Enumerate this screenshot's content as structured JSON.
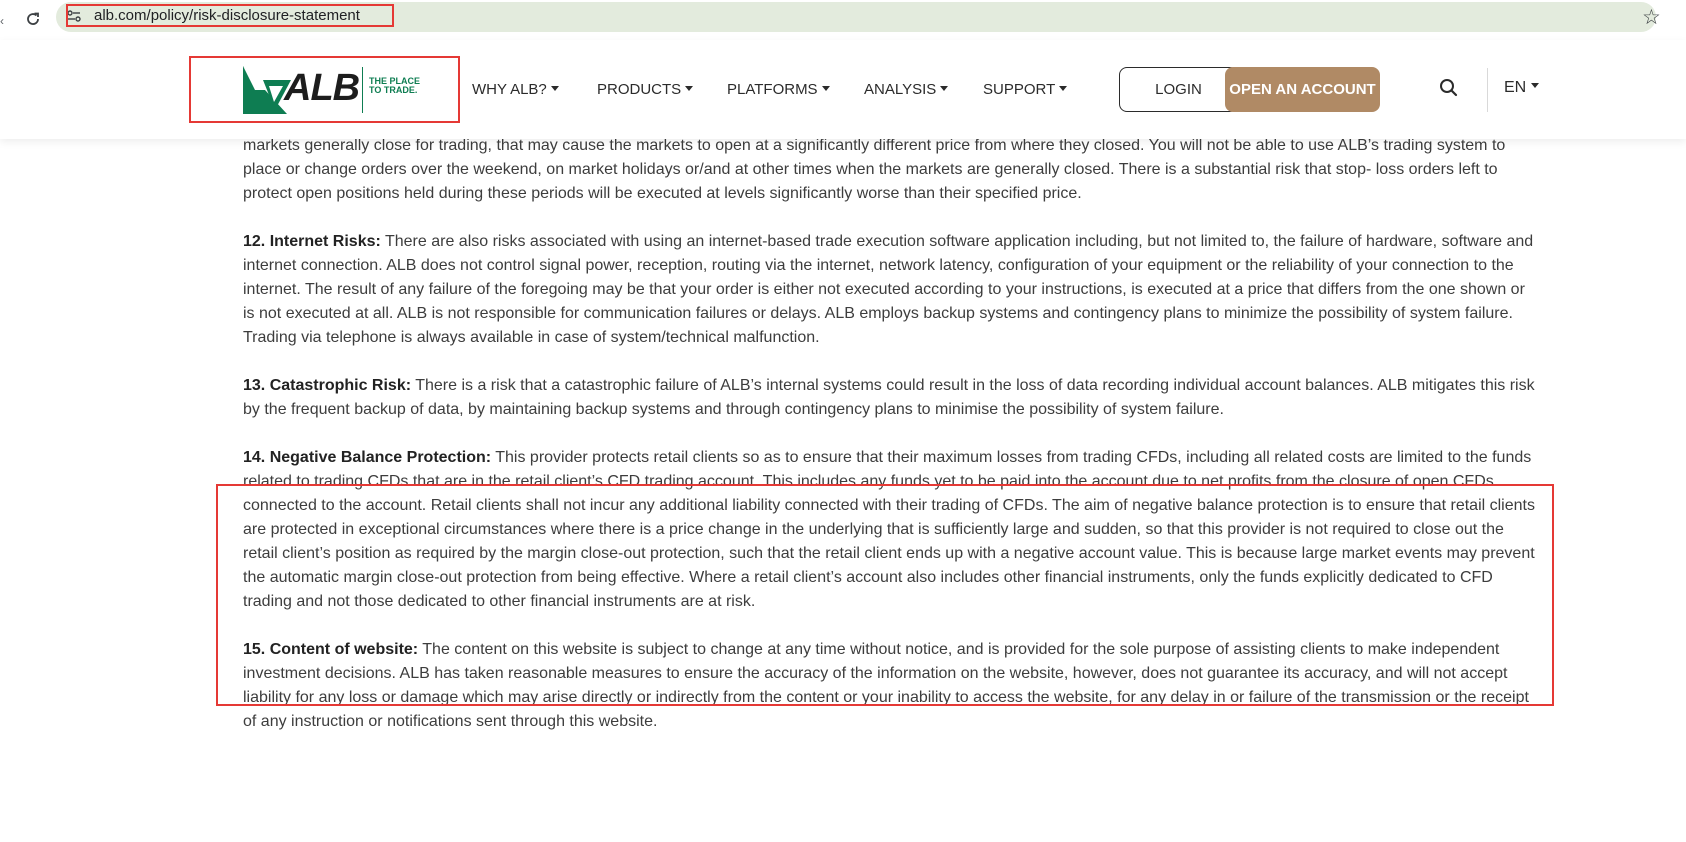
{
  "browser": {
    "url": "alb.com/policy/risk-disclosure-statement",
    "reload_icon": "reload-icon",
    "site_info_icon": "site-info-icon",
    "bookmark_icon": "star-icon"
  },
  "header": {
    "logo_text": "ALB",
    "tagline": "THE PLACE TO TRADE.",
    "nav": [
      {
        "label": "WHY ALB?"
      },
      {
        "label": "PRODUCTS"
      },
      {
        "label": "PLATFORMS"
      },
      {
        "label": "ANALYSIS"
      },
      {
        "label": "SUPPORT"
      }
    ],
    "login_label": "LOGIN",
    "open_account_label": "OPEN AN ACCOUNT",
    "search_icon": "search-icon",
    "language": "EN",
    "colors": {
      "brand_green": "#0e7d52",
      "accent_button": "#b08a65"
    }
  },
  "content": {
    "intro_tail": "markets generally close for trading, that may cause the markets to open at a significantly different price from where they closed. You will not be able to use ALB’s trading system to place or change orders over the weekend, on market holidays or/and at other times when the markets are generally closed. There is a substantial risk that stop- loss orders left to protect open positions held during these periods will be executed at levels significantly worse than their specified price.",
    "sections": [
      {
        "heading": "12. Internet Risks:",
        "body": " There are also risks associated with using an internet-based trade execution software application including, but not limited to, the failure of hardware, software and internet connection. ALB does not control signal power, reception, routing via the internet, network latency, configuration of your equipment or the reliability of your connection to the internet. The result of any failure of the foregoing may be that your order is either not executed according to your instructions, is executed at a price that differs from the one shown or is not executed at all. ALB is not responsible for communication failures or delays. ALB employs backup systems and contingency plans to minimize the possibility of system failure. Trading via telephone is always available in case of system/technical malfunction."
      },
      {
        "heading": "13. Catastrophic Risk:",
        "body": " There is a risk that a catastrophic failure of ALB’s internal systems could result in the loss of data recording individual account balances. ALB mitigates this risk by the frequent backup of data, by maintaining backup systems and through contingency plans to minimise the possibility of system failure."
      },
      {
        "heading": "14. Negative Balance Protection:",
        "body": " This provider protects retail clients so as to ensure that their maximum losses from trading CFDs, including all related costs are limited to the funds related to trading CFDs that are in the retail client’s CFD trading account. This includes any funds yet to be paid into the account due to net profits from the closure of open CFDs connected to the account. Retail clients shall not incur any additional liability connected with their trading of CFDs. The aim of negative balance protection is to ensure that retail clients are protected in exceptional circumstances where there is a price change in the underlying that is sufficiently large and sudden, so that this provider is not required to close out the retail client’s position as required by the margin close-out protection, such that the retail client ends up with a negative account value. This is because large market events may prevent the automatic margin close-out protection from being effective. Where a retail client’s account also includes other financial instruments, only the funds explicitly dedicated to CFD trading and not those dedicated to other financial instruments are at risk."
      },
      {
        "heading": "15. Content of website:",
        "body": " The content on this website is subject to change at any time without notice, and is provided for the sole purpose of assisting clients to make independent investment decisions. ALB has taken reasonable measures to ensure the accuracy of the information on the website, however, does not guarantee its accuracy, and will not accept liability for any loss or damage which may arise directly or indirectly from the content or your inability to access the website, for any delay in or failure of the transmission or the receipt of any instruction or notifications sent through this website."
      }
    ]
  }
}
